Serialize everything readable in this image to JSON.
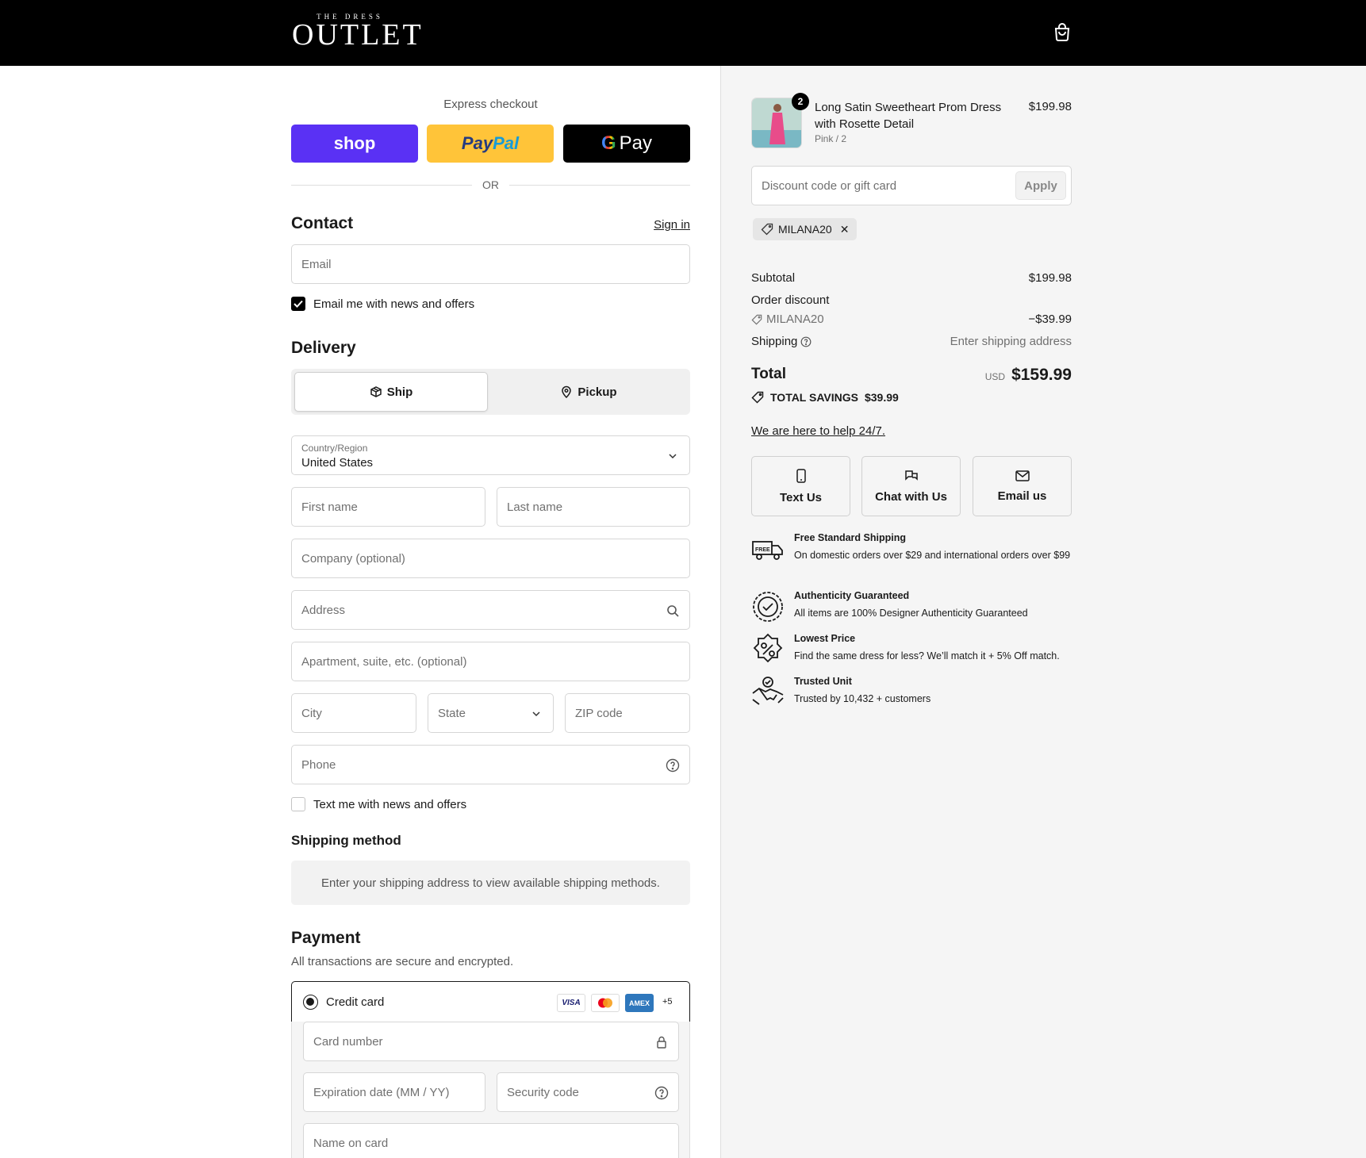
{
  "header": {
    "logo_small": "THE DRESS",
    "logo_big": "OUTLET",
    "cart_icon": "shopping-bag-icon"
  },
  "express": {
    "title": "Express checkout",
    "shop_label": "shop",
    "paypal_label_1": "Pay",
    "paypal_label_2": "Pal",
    "gpay_g": "G",
    "gpay_label": "Pay",
    "or": "OR"
  },
  "contact": {
    "title": "Contact",
    "sign_in": "Sign in",
    "email_placeholder": "Email",
    "email_offers": "Email me with news and offers",
    "email_offers_checked": true
  },
  "delivery": {
    "title": "Delivery",
    "tab_ship": "Ship",
    "tab_pickup": "Pickup",
    "active_tab": "Ship",
    "country_label": "Country/Region",
    "country_value": "United States",
    "first_name": "First name",
    "last_name": "Last name",
    "company": "Company (optional)",
    "address": "Address",
    "apartment": "Apartment, suite, etc. (optional)",
    "city": "City",
    "state": "State",
    "zip": "ZIP code",
    "phone": "Phone",
    "text_offers": "Text me with news and offers",
    "text_offers_checked": false
  },
  "shipping_method": {
    "title": "Shipping method",
    "notice": "Enter your shipping address to view available shipping methods."
  },
  "payment": {
    "title": "Payment",
    "subtitle": "All transactions are secure and encrypted.",
    "method": "Credit card",
    "card_logos": [
      "VISA",
      "mastercard",
      "AMEX",
      "+5"
    ],
    "card_number": "Card number",
    "expiration": "Expiration date (MM / YY)",
    "security_code": "Security code",
    "name_on_card": "Name on card"
  },
  "order": {
    "product_name": "Long Satin Sweetheart Prom Dress with Rosette Detail",
    "variant": "Pink / 2",
    "quantity": "2",
    "price": "$199.98",
    "discount_placeholder": "Discount code or gift card",
    "apply": "Apply",
    "applied_code": "MILANA20",
    "subtotal_label": "Subtotal",
    "subtotal": "$199.98",
    "order_discount_label": "Order discount",
    "discount_code": "MILANA20",
    "discount_amount": "−$39.99",
    "shipping_label": "Shipping",
    "shipping_value": "Enter shipping address",
    "total_label": "Total",
    "currency": "USD",
    "total": "$159.99",
    "savings_label": "TOTAL SAVINGS",
    "savings": "$39.99"
  },
  "support": {
    "help_link": "We are here to help 24/7.",
    "text_us": "Text Us",
    "chat_us": "Chat with Us",
    "email_us": "Email us"
  },
  "perks": [
    {
      "title": "Free Standard Shipping",
      "desc": "On domestic orders over $29 and international orders over $99",
      "icon": "free-shipping-truck-icon"
    },
    {
      "title": "Authenticity Guaranteed",
      "desc": "All items are 100% Designer Authenticity Guaranteed",
      "icon": "verified-badge-icon"
    },
    {
      "title": "Lowest Price",
      "desc": "Find the same dress for less? We’ll match it + 5% Off match.",
      "icon": "percent-badge-icon"
    },
    {
      "title": "Trusted Unit",
      "desc": "Trusted by 10,432 + customers",
      "icon": "handshake-icon"
    }
  ],
  "colors": {
    "shop_pay": "#5a31f4",
    "paypal": "#ffc439",
    "header": "#000000",
    "panel": "#f5f5f5"
  }
}
